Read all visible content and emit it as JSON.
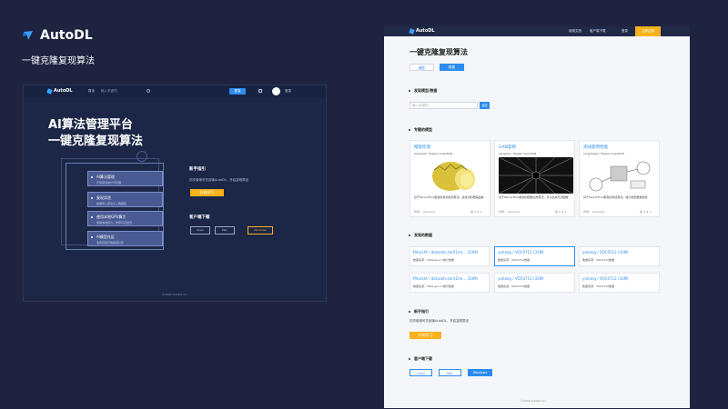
{
  "brand": {
    "name": "AutoDL",
    "subtitle": "一键克隆复现算法"
  },
  "left_mock": {
    "logo": "AutoDL",
    "nav": [
      "算法",
      "输入关键词"
    ],
    "login": "登录",
    "user": "登录",
    "hero_title": [
      "AI算法管理平台",
      "一键克隆复现算法"
    ],
    "features": [
      {
        "title": "AI算法管理",
        "desc": "已有算法统计与管理"
      },
      {
        "title": "复现实验",
        "desc": "数据导入算法汇入数据集"
      },
      {
        "title": "使用本地GPU算力",
        "desc": "使用本地算力，效率高且经济"
      },
      {
        "title": "AI模型社区",
        "desc": "免费获取开放模型社区"
      }
    ],
    "guide_title": "新手指引",
    "guide_desc": "初次使用可先阅读AutoDL，开启复现算法",
    "guide_btn": "开始学习",
    "download_title": "客户端下载",
    "downloads": [
      "Linux",
      "Mac",
      "Windows"
    ],
    "footer": "©2020 AutoDL  Inc."
  },
  "right_mock": {
    "logo": "AutoDL",
    "nav": [
      "使用文档",
      "客户端下载",
      "登录",
      "立即注册"
    ],
    "title": "一键克隆复现算法",
    "tabs": [
      "模型",
      "数据"
    ],
    "search_title": "发现模型/数据",
    "search_placeholder": "输入关键词",
    "search_btn": "搜索",
    "featured_title": "专题的模型",
    "models": [
      {
        "title": "榴莲检测",
        "path": "weiqiqiqi / Stagan-SuenRGN",
        "desc": "基于TensorFlow框架的目标检测算法，适合识别榴莲品种",
        "author": "作者： zhuhang",
        "stats": "赞 5 ★ 3"
      },
      {
        "title": "GAN案例",
        "path": "yangzhq / Stagan-SuenPGN",
        "desc": "基于TensorFlow框架的图像生成算法，可以生成高清图像",
        "author": "作者： zhuhang",
        "stats": "赞 5 ★ 3"
      },
      {
        "title": "测试使用性能",
        "path": "yangzhqjia / Stagan-SuenPGN",
        "desc": "基于TensorFlow框架的测试算法，统计模型推理性能",
        "author": "作者： zhuhang",
        "stats": "赞 5 ★ 3"
      }
    ],
    "datasets_title": "发现的数据",
    "datasets": [
      {
        "title": "PHacUX / datasets.tarl(1/re... (33M)",
        "desc": "数据来源：stats.gov.cn统计数据"
      },
      {
        "title": "yuhang / VOC0712 (33M)",
        "desc": "数据来源：VOC0712数据"
      },
      {
        "title": "yuhang / VOC0712 (33M)",
        "desc": "数据来源：VOC0712数据"
      },
      {
        "title": "PHacUX / datasets.tarl(1/re... (33M)",
        "desc": "数据来源：stats.gov.cn统计数据"
      },
      {
        "title": "yuhang / VOC0712 (33M)",
        "desc": "数据来源：VOC0712数据"
      },
      {
        "title": "yuhang / VOC0712 (33M)",
        "desc": "数据来源：VOC0712数据"
      }
    ],
    "guide_title": "新手指引",
    "guide_desc": "初次使用可先阅读AutoDL，开启复现算法",
    "guide_btn": "开始学习",
    "download_title": "客户端下载",
    "downloads": [
      "Linux",
      "Mac",
      "Windows"
    ],
    "footer": "©2020 AutoDL  Inc."
  },
  "colors": {
    "bg": "#1e2340",
    "accent": "#2d8cf0",
    "yellow": "#f7b21c"
  }
}
